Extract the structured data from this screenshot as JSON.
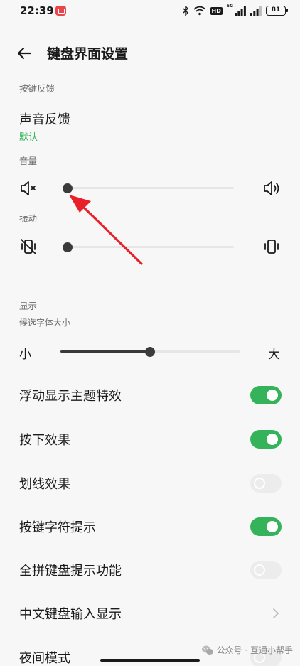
{
  "status_bar": {
    "time": "22:39",
    "app_icon": "gallery-icon",
    "network_label": "5G",
    "hd_label": "HD",
    "battery": "81"
  },
  "header": {
    "back_icon": "arrow-left-icon",
    "title": "键盘界面设置"
  },
  "key_feedback": {
    "section_label": "按键反馈",
    "sound": {
      "title": "声音反馈",
      "subtitle": "默认"
    },
    "volume": {
      "label": "音量",
      "value": 0.0,
      "min_icon": "speaker-mute-icon",
      "max_icon": "speaker-loud-icon"
    },
    "vibration": {
      "label": "振动",
      "value": 0.0,
      "min_icon": "vibrate-off-icon",
      "max_icon": "vibrate-icon"
    }
  },
  "display": {
    "section_label": "显示",
    "font_size": {
      "label": "候选字体大小",
      "min_label": "小",
      "max_label": "大",
      "value": 0.5
    }
  },
  "settings": [
    {
      "label": "浮动显示主题特效",
      "type": "toggle",
      "on": true
    },
    {
      "label": "按下效果",
      "type": "toggle",
      "on": true
    },
    {
      "label": "划线效果",
      "type": "toggle",
      "on": false
    },
    {
      "label": "按键字符提示",
      "type": "toggle",
      "on": true
    },
    {
      "label": "全拼键盘提示功能",
      "type": "toggle",
      "on": false
    },
    {
      "label": "中文键盘输入显示",
      "type": "link"
    },
    {
      "label": "夜间模式",
      "type": "toggle",
      "on": false
    }
  ],
  "watermark": {
    "text": "公众号 · 互通小帮手",
    "icon": "wechat-icon"
  },
  "colors": {
    "accent": "#34b35a",
    "annotation": "#e8202a",
    "background": "#f7f7f7"
  }
}
